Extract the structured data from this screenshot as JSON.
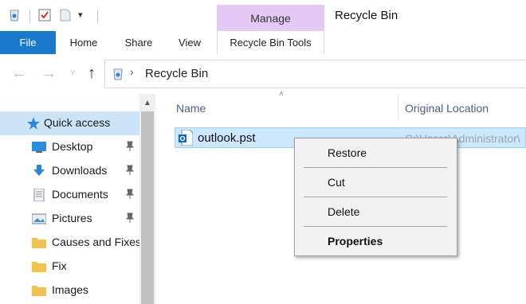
{
  "title_bar": {
    "window_title": "Recycle Bin",
    "contextual_tab_group": "Manage"
  },
  "ribbon": {
    "tabs": [
      {
        "label": "File"
      },
      {
        "label": "Home"
      },
      {
        "label": "Share"
      },
      {
        "label": "View"
      },
      {
        "label": "Recycle Bin Tools"
      }
    ]
  },
  "address_bar": {
    "path": "Recycle Bin"
  },
  "nav_pane": {
    "items": [
      {
        "label": "Quick access",
        "icon": "star-icon",
        "pinned": false,
        "selected": true
      },
      {
        "label": "Desktop",
        "icon": "desktop-icon",
        "pinned": true
      },
      {
        "label": "Downloads",
        "icon": "download-icon",
        "pinned": true
      },
      {
        "label": "Documents",
        "icon": "documents-icon",
        "pinned": true
      },
      {
        "label": "Pictures",
        "icon": "pictures-icon",
        "pinned": true
      },
      {
        "label": "Causes and Fixes",
        "icon": "folder-icon",
        "pinned": false
      },
      {
        "label": "Fix",
        "icon": "folder-icon",
        "pinned": false
      },
      {
        "label": "Images",
        "icon": "folder-icon",
        "pinned": false
      }
    ]
  },
  "file_list": {
    "columns": [
      "Name",
      "Original Location"
    ],
    "rows": [
      {
        "name": "outlook.pst",
        "original_location": "C:\\Users\\Administrator\\"
      }
    ]
  },
  "context_menu": {
    "items": [
      "Restore",
      "Cut",
      "Delete",
      "Properties"
    ]
  },
  "colors": {
    "file_tab": "#1979ca",
    "manage_tab": "#e6c8f5",
    "selection": "#cce8ff"
  }
}
